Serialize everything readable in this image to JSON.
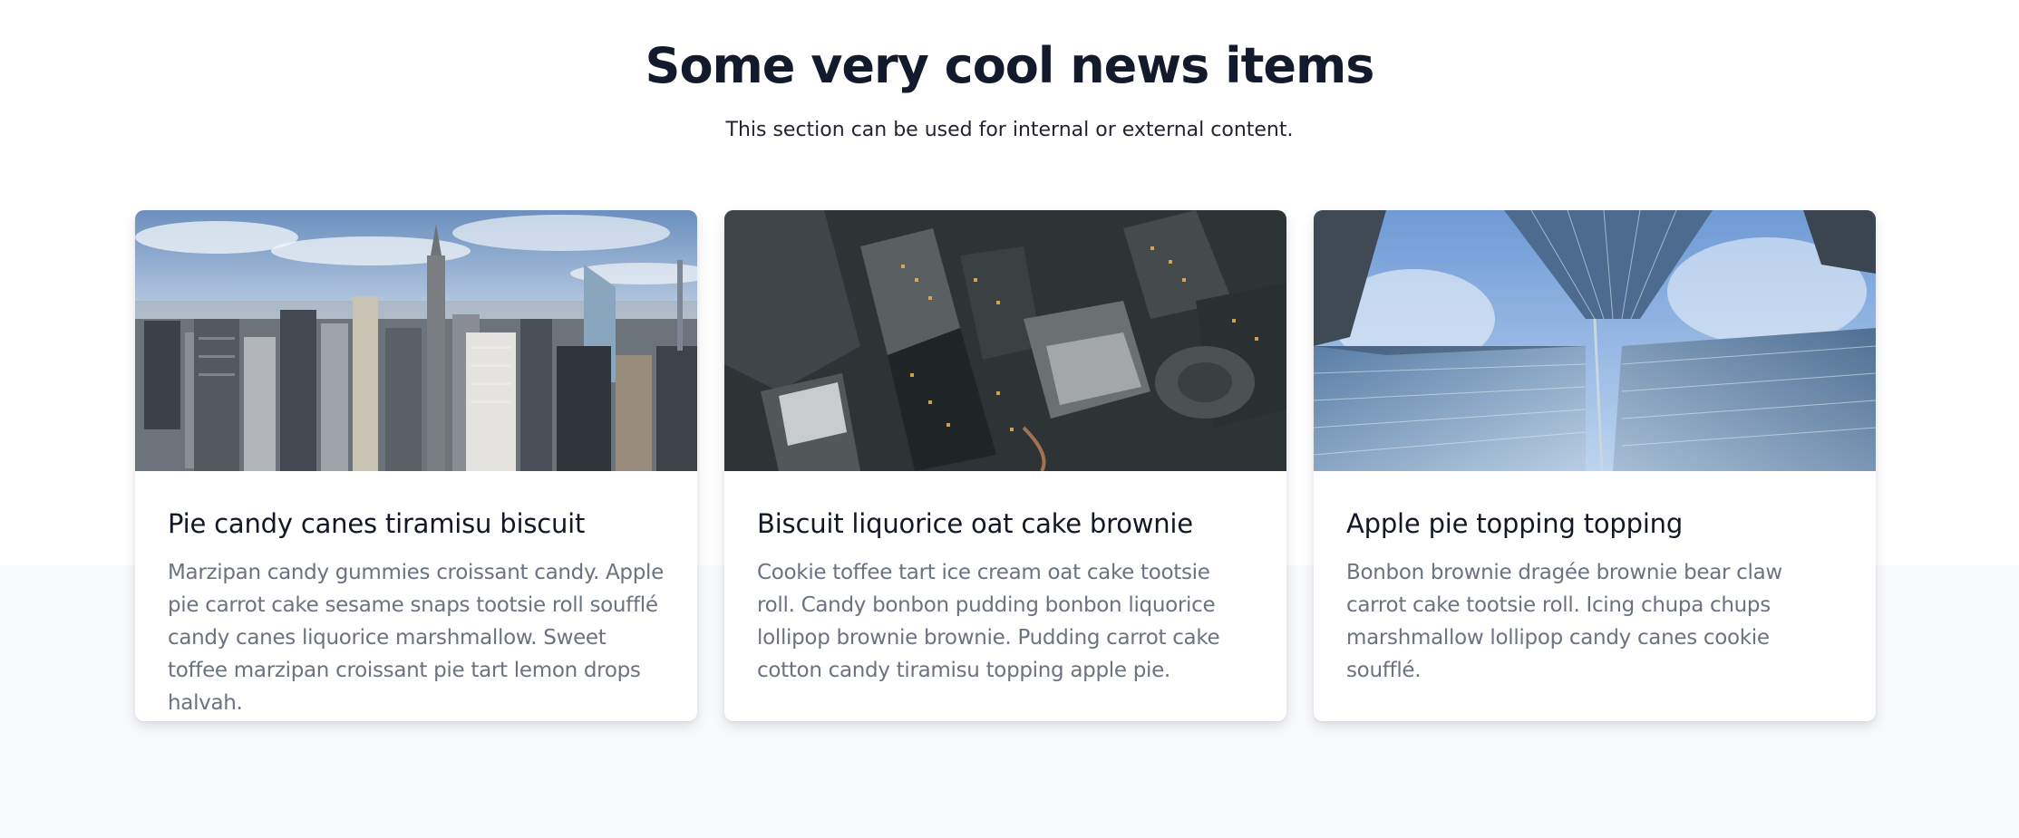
{
  "header": {
    "title": "Some very cool news items",
    "subtitle": "This section can be used for internal or external content."
  },
  "cards": [
    {
      "image": "city-skyline-photo",
      "title": "Pie candy canes tiramisu biscuit",
      "text": "Marzipan candy gummies croissant candy. Apple pie carrot cake sesame snaps tootsie roll soufflé candy canes liquorice marshmallow. Sweet toffee marzipan croissant pie tart lemon drops halvah."
    },
    {
      "image": "aerial-city-photo",
      "title": "Biscuit liquorice oat cake brownie",
      "text": "Cookie toffee tart ice cream oat cake tootsie roll. Candy bonbon pudding bonbon liquorice lollipop brownie brownie. Pudding carrot cake cotton candy tiramisu topping apple pie."
    },
    {
      "image": "skyscrapers-looking-up-photo",
      "title": "Apple pie topping topping",
      "text": "Bonbon brownie dragée brownie bear claw carrot cake tootsie roll. Icing chupa chups marshmallow lollipop candy canes cookie soufflé."
    }
  ],
  "colors": {
    "heading": "#131a2b",
    "body_text": "#6b7280",
    "band_background": "#f8f9fb",
    "card_background": "#ffffff"
  }
}
